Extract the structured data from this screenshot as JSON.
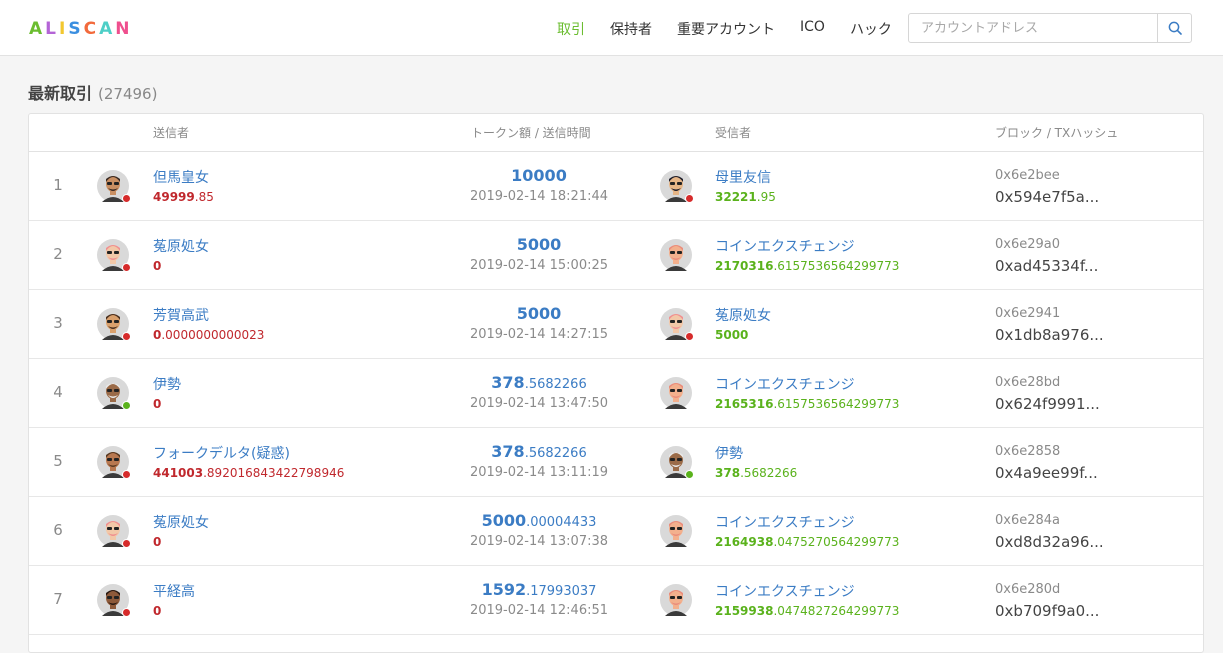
{
  "logo": {
    "letters": [
      {
        "ch": "A",
        "color": "#6bbd30"
      },
      {
        "ch": "L",
        "color": "#b464d6"
      },
      {
        "ch": "I",
        "color": "#f2c72f"
      },
      {
        "ch": "S",
        "color": "#3b8fe0"
      },
      {
        "ch": "C",
        "color": "#f26a3c"
      },
      {
        "ch": "A",
        "color": "#4ecfc7"
      },
      {
        "ch": "N",
        "color": "#ef4f8e"
      }
    ]
  },
  "nav": {
    "items": [
      "取引",
      "保持者",
      "重要アカウント",
      "ICO",
      "ハック"
    ],
    "active_index": 0
  },
  "search": {
    "placeholder": "アカウントアドレス"
  },
  "heading": {
    "title": "最新取引",
    "count": "(27496)"
  },
  "columns": {
    "sender": "送信者",
    "amount": "トークン額 / 送信時間",
    "receiver": "受信者",
    "block": "ブロック / TXハッシュ"
  },
  "colors": {
    "red_dot": "#d62b2b",
    "green_dot": "#5ab21c",
    "link": "#3b7cc4"
  },
  "rows": [
    {
      "idx": "1",
      "sender": {
        "name": "但馬皇女",
        "bal_int": "49999",
        "bal_frac": ".85",
        "dot": "red",
        "skin": "#c98f62",
        "hair": "#3a2a22"
      },
      "amount_int": "10000",
      "amount_frac": "",
      "time": "2019-02-14 18:21:44",
      "receiver": {
        "name": "母里友信",
        "bal_int": "32221",
        "bal_frac": ".95",
        "dot": "red",
        "skin": "#e6b687",
        "hair": "#1e1e2a"
      },
      "block": "0x6e2bee",
      "tx": "0x594e7f5a..."
    },
    {
      "idx": "2",
      "sender": {
        "name": "菟原処女",
        "bal_int": "0",
        "bal_frac": "",
        "dot": "red",
        "skin": "#f2c8a8",
        "hair": "#f09090"
      },
      "amount_int": "5000",
      "amount_frac": "",
      "time": "2019-02-14 15:00:25",
      "receiver": {
        "name": "コインエクスチェンジ",
        "bal_int": "2170316",
        "bal_frac": ".6157536564299773",
        "dot": "none",
        "skin": "#f3b08d",
        "hair": "#ea8d7c"
      },
      "block": "0x6e29a0",
      "tx": "0xad45334f..."
    },
    {
      "idx": "3",
      "sender": {
        "name": "芳賀高武",
        "bal_int": "0",
        "bal_frac": ".0000000000023",
        "dot": "red",
        "skin": "#d9a06c",
        "hair": "#4a3020"
      },
      "amount_int": "5000",
      "amount_frac": "",
      "time": "2019-02-14 14:27:15",
      "receiver": {
        "name": "菟原処女",
        "bal_int": "5000",
        "bal_frac": "",
        "dot": "red",
        "skin": "#f2c8a8",
        "hair": "#f09090"
      },
      "block": "0x6e2941",
      "tx": "0x1db8a976..."
    },
    {
      "idx": "4",
      "sender": {
        "name": "伊勢",
        "bal_int": "0",
        "bal_frac": "",
        "dot": "green",
        "skin": "#9b6b48",
        "hair": "#e8e8e8"
      },
      "amount_int": "378",
      "amount_frac": ".5682266",
      "time": "2019-02-14 13:47:50",
      "receiver": {
        "name": "コインエクスチェンジ",
        "bal_int": "2165316",
        "bal_frac": ".6157536564299773",
        "dot": "none",
        "skin": "#f3b08d",
        "hair": "#ea8d7c"
      },
      "block": "0x6e28bd",
      "tx": "0x624f9991..."
    },
    {
      "idx": "5",
      "sender": {
        "name": "フォークデルタ(疑惑)",
        "bal_int": "441003",
        "bal_frac": ".892016843422798946",
        "dot": "red",
        "skin": "#b87850",
        "hair": "#5a3a22"
      },
      "amount_int": "378",
      "amount_frac": ".5682266",
      "time": "2019-02-14 13:11:19",
      "receiver": {
        "name": "伊勢",
        "bal_int": "378",
        "bal_frac": ".5682266",
        "dot": "green",
        "skin": "#9b6b48",
        "hair": "#e8e8e8"
      },
      "block": "0x6e2858",
      "tx": "0x4a9ee99f..."
    },
    {
      "idx": "6",
      "sender": {
        "name": "菟原処女",
        "bal_int": "0",
        "bal_frac": "",
        "dot": "red",
        "skin": "#f2c8a8",
        "hair": "#f09090"
      },
      "amount_int": "5000",
      "amount_frac": ".00004433",
      "time": "2019-02-14 13:07:38",
      "receiver": {
        "name": "コインエクスチェンジ",
        "bal_int": "2164938",
        "bal_frac": ".0475270564299773",
        "dot": "none",
        "skin": "#f3b08d",
        "hair": "#ea8d7c"
      },
      "block": "0x6e284a",
      "tx": "0xd8d32a96..."
    },
    {
      "idx": "7",
      "sender": {
        "name": "平経高",
        "bal_int": "0",
        "bal_frac": "",
        "dot": "red",
        "skin": "#8e5a3a",
        "hair": "#2a1a12"
      },
      "amount_int": "1592",
      "amount_frac": ".17993037",
      "time": "2019-02-14 12:46:51",
      "receiver": {
        "name": "コインエクスチェンジ",
        "bal_int": "2159938",
        "bal_frac": ".0474827264299773",
        "dot": "none",
        "skin": "#f3b08d",
        "hair": "#ea8d7c"
      },
      "block": "0x6e280d",
      "tx": "0xb709f9a0..."
    }
  ]
}
